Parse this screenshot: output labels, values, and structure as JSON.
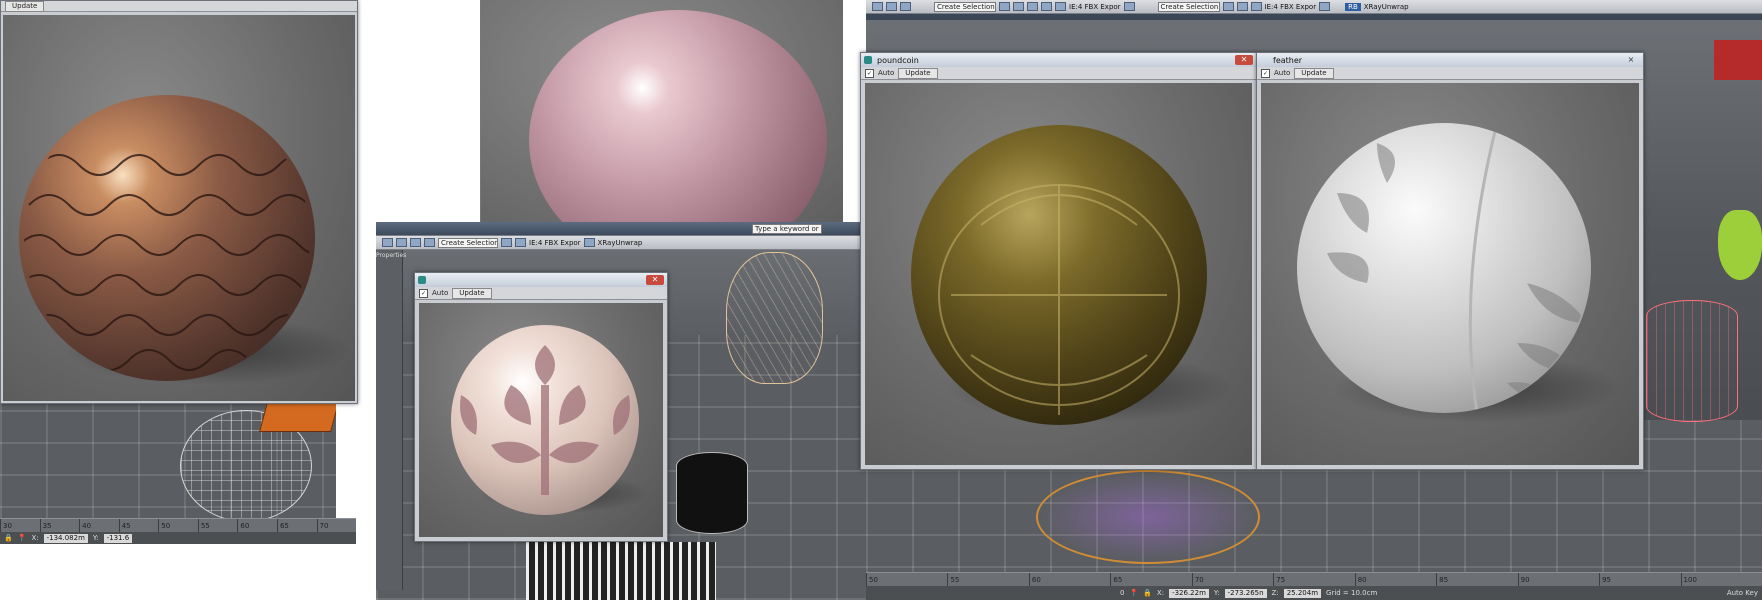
{
  "left_viewport": {
    "top_label": "Update",
    "timeline_ticks": [
      "30",
      "35",
      "40",
      "45",
      "50",
      "55",
      "60",
      "65",
      "70"
    ],
    "status_x": "-134.082m",
    "status_y_label": "Y:",
    "status_y": "-131.6"
  },
  "center_viewport": {
    "toolbar_fields": [
      "Type a keyword or phrase",
      "Create Selection Se"
    ],
    "toolbar_label": "IE:4 FBX Expor",
    "toolbar_right": "XRayUnwrap",
    "side_label": "Properties"
  },
  "small_window": {
    "title": "",
    "auto_label": "Auto",
    "update_label": "Update"
  },
  "right_viewport": {
    "toolbar_field": "Create Selection Se",
    "toolbar_label": "IE:4 FBX Expor",
    "toolbar_field2": "Create Selection Se",
    "toolbar_label2": "IE:4 FBX Expor",
    "rb_label": "RB",
    "xray_label": "XRayUnwrap",
    "timeline_ticks": [
      "50",
      "55",
      "60",
      "65",
      "70",
      "75",
      "80",
      "85",
      "90",
      "95",
      "100"
    ],
    "timeline_start": "0",
    "status_x": "-326.22m",
    "status_y": "-273.265n",
    "status_z_label": "Z:",
    "status_z": "25.204m",
    "grid_label": "Grid = 10.0cm",
    "auto_key": "Auto Key"
  },
  "poundcoin_window": {
    "title": "poundcoin",
    "auto_label": "Auto",
    "update_label": "Update",
    "close_glyph": "✕"
  },
  "feather_window": {
    "title": "feather",
    "auto_label": "Auto",
    "update_label": "Update",
    "close_glyph": "⨯"
  },
  "colors": {
    "viewport_bg": "#5a5d61",
    "toolbar": "#c9ccd1",
    "close_red": "#c74a3d",
    "title_bar": "#d6dde6"
  }
}
